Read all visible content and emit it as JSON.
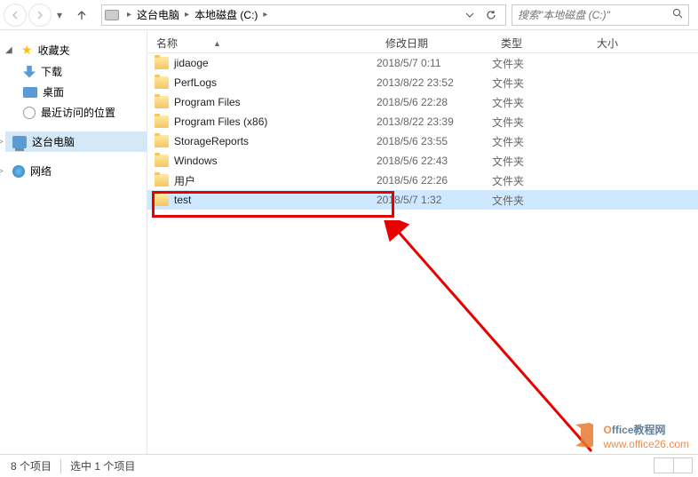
{
  "toolbar": {
    "breadcrumb": [
      "这台电脑",
      "本地磁盘 (C:)"
    ],
    "search_placeholder": "搜索\"本地磁盘 (C:)\""
  },
  "sidebar": {
    "favorites_label": "收藏夹",
    "fav_items": [
      {
        "label": "下载",
        "icon": "download"
      },
      {
        "label": "桌面",
        "icon": "desktop"
      },
      {
        "label": "最近访问的位置",
        "icon": "recent"
      }
    ],
    "this_pc_label": "这台电脑",
    "network_label": "网络"
  },
  "columns": {
    "name": "名称",
    "date": "修改日期",
    "type": "类型",
    "size": "大小"
  },
  "files": [
    {
      "name": "jidaoge",
      "date": "2018/5/7 0:11",
      "type": "文件夹"
    },
    {
      "name": "PerfLogs",
      "date": "2013/8/22 23:52",
      "type": "文件夹"
    },
    {
      "name": "Program Files",
      "date": "2018/5/6 22:28",
      "type": "文件夹"
    },
    {
      "name": "Program Files (x86)",
      "date": "2013/8/22 23:39",
      "type": "文件夹"
    },
    {
      "name": "StorageReports",
      "date": "2018/5/6 23:55",
      "type": "文件夹"
    },
    {
      "name": "Windows",
      "date": "2018/5/6 22:43",
      "type": "文件夹"
    },
    {
      "name": "用户",
      "date": "2018/5/6 22:26",
      "type": "文件夹"
    },
    {
      "name": "test",
      "date": "2018/5/7 1:32",
      "type": "文件夹",
      "selected": true
    }
  ],
  "statusbar": {
    "item_count": "8 个项目",
    "selection": "选中 1 个项目"
  },
  "watermark": {
    "title_prefix": "O",
    "title_rest": "ffice教程网",
    "url": "www.office26.com"
  }
}
